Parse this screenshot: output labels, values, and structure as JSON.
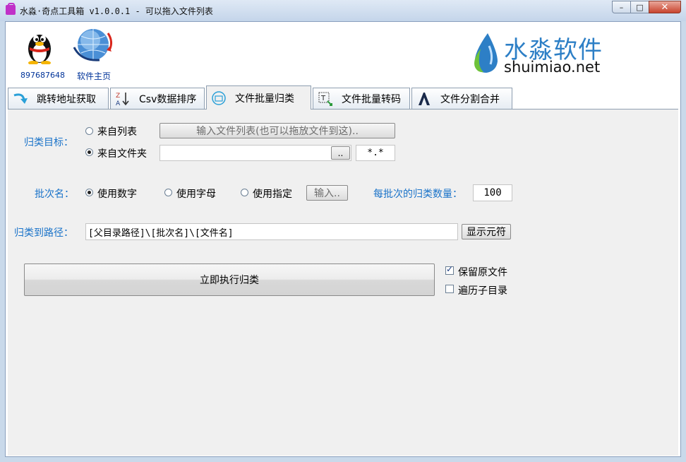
{
  "window": {
    "title": "水淼·奇点工具箱 v1.0.0.1 - 可以拖入文件列表",
    "minimize": "–",
    "maximize": "□",
    "close": "✕"
  },
  "header": {
    "qq_number": "897687648",
    "home_label": "软件主页",
    "brand_name": "水淼软件",
    "brand_url": "shuimiao.net",
    "brand_color": "#2d7fc6"
  },
  "tabs": [
    {
      "label": "跳转地址获取",
      "icon": "redirect-arrow-icon"
    },
    {
      "label": "Csv数据排序",
      "icon": "sort-az-icon"
    },
    {
      "label": "文件批量归类",
      "icon": "classify-icon",
      "active": true
    },
    {
      "label": "文件批量转码",
      "icon": "text-convert-icon"
    },
    {
      "label": "文件分割合并",
      "icon": "split-merge-icon"
    }
  ],
  "form": {
    "target_label": "归类目标：",
    "from_list_label": "来自列表",
    "from_list_button": "输入文件列表(也可以拖放文件到这)..",
    "from_folder_label": "来自文件夹",
    "folder_path": "",
    "browse_button": "..",
    "filter": "*.*",
    "batch_label": "批次名：",
    "use_number": "使用数字",
    "use_letter": "使用字母",
    "use_custom": "使用指定",
    "custom_button": "输入..",
    "per_batch_label": "每批次的归类数量：",
    "per_batch_value": "100",
    "dest_label": "归类到路径：",
    "dest_path": "[父目录路径]\\[批次名]\\[文件名]",
    "show_tokens_button": "显示元符",
    "run_button": "立即执行归类",
    "keep_original": "保留原文件",
    "traverse_subdirs": "遍历子目录"
  },
  "state": {
    "target": "folder",
    "batch_mode": "number",
    "keep_original": true,
    "traverse_subdirs": false
  },
  "colors": {
    "label_blue": "#1a73c9",
    "link_blue": "#003399",
    "panel_bg": "#f0f0f0"
  }
}
